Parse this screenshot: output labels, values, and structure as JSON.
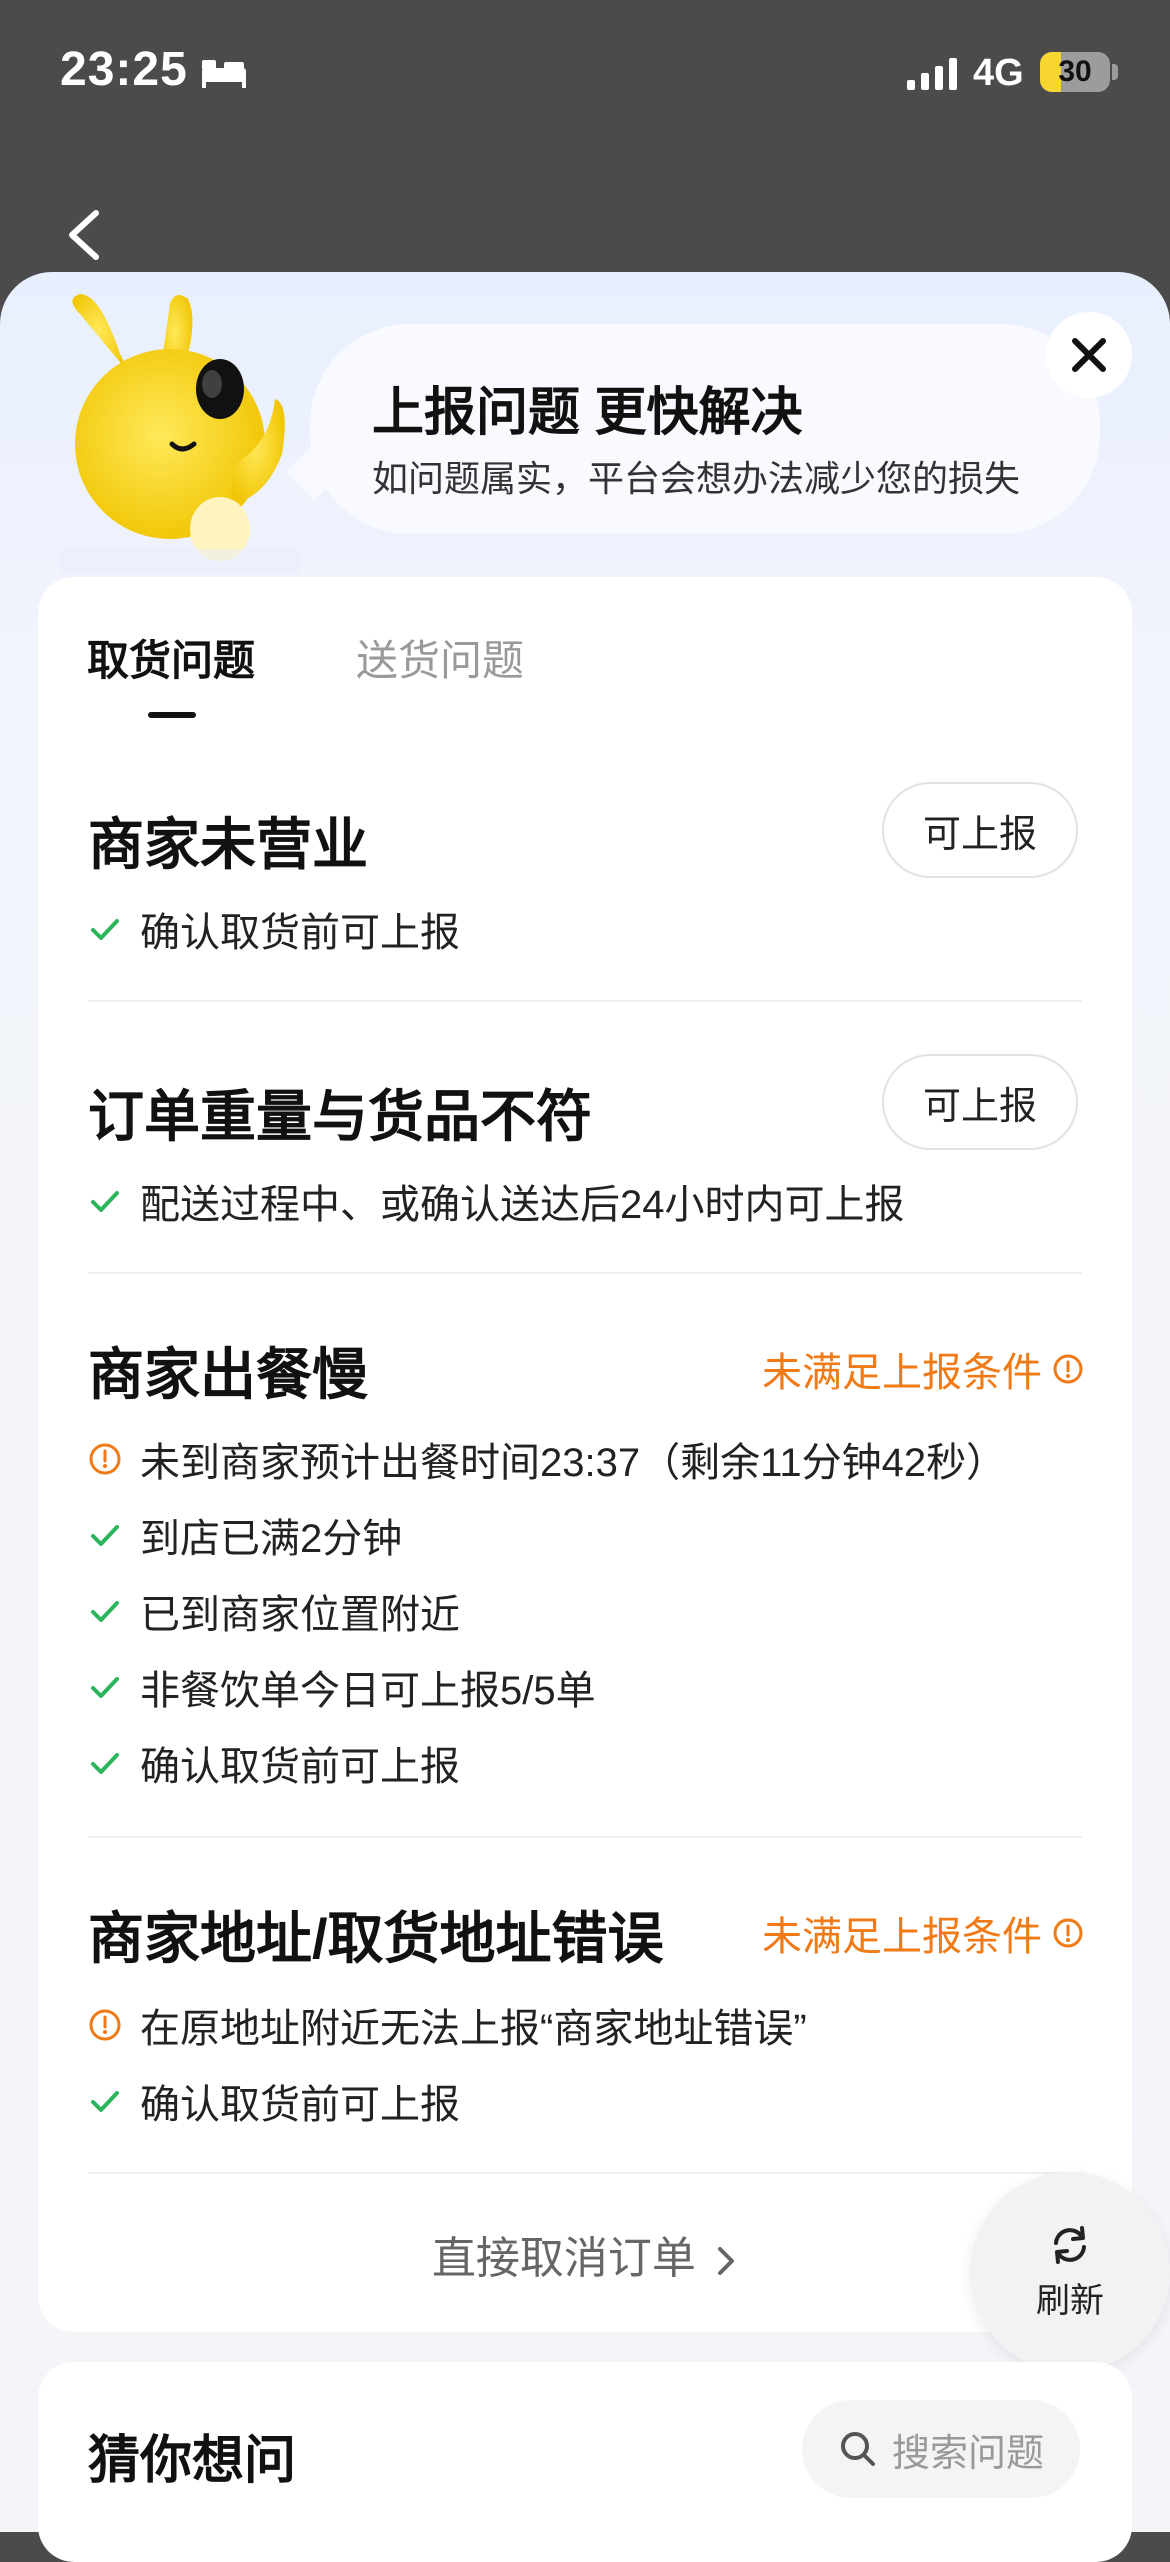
{
  "status_bar": {
    "time": "23:25",
    "network": "4G",
    "battery": "30",
    "battery_level": 0.3
  },
  "header": {
    "title": "上报问题 更快解决",
    "subtitle": "如问题属实，平台会想办法减少您的损失"
  },
  "tabs": [
    {
      "label": "取货问题",
      "active": true
    },
    {
      "label": "送货问题",
      "active": false
    }
  ],
  "issues": [
    {
      "title": "商家未营业",
      "button": "可上报",
      "conditions": [
        {
          "status": "ok",
          "text": "确认取货前可上报"
        }
      ]
    },
    {
      "title": "订单重量与货品不符",
      "button": "可上报",
      "conditions": [
        {
          "status": "ok",
          "text": "配送过程中、或确认送达后24小时内可上报"
        }
      ]
    },
    {
      "title": "商家出餐慢",
      "status_label": "未满足上报条件",
      "conditions": [
        {
          "status": "warn",
          "text": "未到商家预计出餐时间23:37（剩余11分钟42秒）"
        },
        {
          "status": "ok",
          "text": "到店已满2分钟"
        },
        {
          "status": "ok",
          "text": "已到商家位置附近"
        },
        {
          "status": "ok",
          "text": "非餐饮单今日可上报5/5单"
        },
        {
          "status": "ok",
          "text": "确认取货前可上报"
        }
      ]
    },
    {
      "title": "商家地址/取货地址错误",
      "status_label": "未满足上报条件",
      "conditions": [
        {
          "status": "warn",
          "text": "在原地址附近无法上报“商家地址错误”"
        },
        {
          "status": "ok",
          "text": "确认取货前可上报"
        }
      ]
    }
  ],
  "footer": {
    "cancel_link": "直接取消订单",
    "refresh_label": "刷新"
  },
  "guess": {
    "title": "猜你想问",
    "search_placeholder": "搜索问题"
  },
  "colors": {
    "accent_orange": "#ef7a16",
    "check_green": "#2bb55a",
    "mascot_yellow": "#f6d320"
  },
  "icons": [
    "bed-icon",
    "signal-icon",
    "back-icon",
    "close-icon",
    "check-icon",
    "warning-icon",
    "info-icon",
    "chevron-right-icon",
    "refresh-icon",
    "search-icon"
  ]
}
